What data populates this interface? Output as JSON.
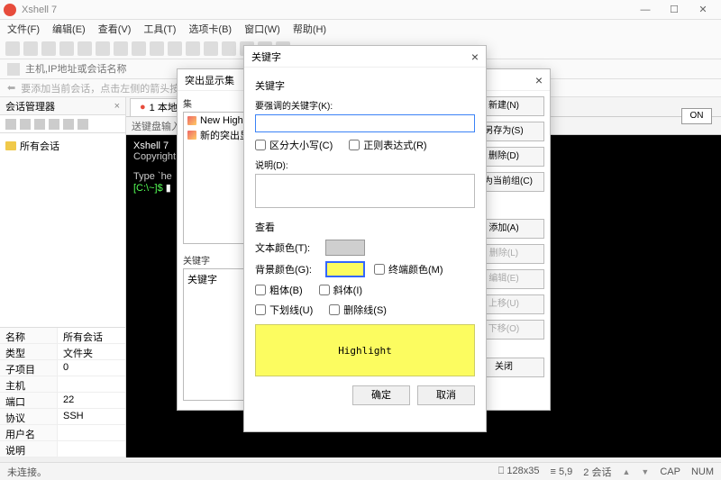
{
  "window": {
    "title": "Xshell 7",
    "min": "—",
    "max": "☐",
    "close": "✕"
  },
  "menu": [
    "文件(F)",
    "编辑(E)",
    "查看(V)",
    "工具(T)",
    "选项卡(B)",
    "窗口(W)",
    "帮助(H)"
  ],
  "hostbar": {
    "placeholder": "主机,IP地址或会话名称"
  },
  "hint": "要添加当前会话，点击左侧的箭头按钮。",
  "session_mgr": {
    "title": "会话管理器",
    "tree_root": "所有会话"
  },
  "props": [
    {
      "k": "名称",
      "v": "所有会话"
    },
    {
      "k": "类型",
      "v": "文件夹"
    },
    {
      "k": "子项目",
      "v": "0"
    },
    {
      "k": "主机",
      "v": ""
    },
    {
      "k": "端口",
      "v": "22"
    },
    {
      "k": "协议",
      "v": "SSH"
    },
    {
      "k": "用户名",
      "v": ""
    },
    {
      "k": "说明",
      "v": ""
    }
  ],
  "tab": {
    "label": "1 本地"
  },
  "sendbar": "送键盘输入",
  "term": {
    "l1": "Xshell 7",
    "l2": "Copyright",
    "l3a": "Type `he",
    "l3b": "[C:\\~]$ ",
    "cursor": "▮"
  },
  "onbtn": "ON",
  "dlg1": {
    "title": "突出显示集",
    "group_label": "集",
    "items": [
      "New Highlight",
      "新的突出显"
    ],
    "kw_label": "关键字",
    "kw_items": [
      "关键字"
    ],
    "buttons": {
      "new": "新建(N)",
      "saveas": "另存为(S)",
      "delete": "删除(D)",
      "setdefault": "置为当前组(C)",
      "add": "添加(A)",
      "del2": "删除(L)",
      "edit": "编辑(E)",
      "up": "上移(U)",
      "down": "下移(O)",
      "close": "关闭"
    }
  },
  "dlg2": {
    "title": "关键字",
    "section1": "关键字",
    "keyword_label": "要强调的关键字(K):",
    "keyword_value": "",
    "case": "区分大小写(C)",
    "regex": "正则表达式(R)",
    "desc_label": "说明(D):",
    "desc_value": "",
    "section2": "查看",
    "textcolor": "文本颜色(T):",
    "bgcolor": "背景颜色(G):",
    "termcolor": "终端颜色(M)",
    "bold": "粗体(B)",
    "italic": "斜体(I)",
    "underline": "下划线(U)",
    "strike": "删除线(S)",
    "preview": "Highlight",
    "ok": "确定",
    "cancel": "取消",
    "colors": {
      "text": "#cfcfcf",
      "bg": "#fcfc60"
    }
  },
  "status": {
    "left": "未连接。",
    "size": "128x35",
    "pos": "5,9",
    "sessions": "2 会话",
    "cap": "CAP",
    "num": "NUM"
  }
}
